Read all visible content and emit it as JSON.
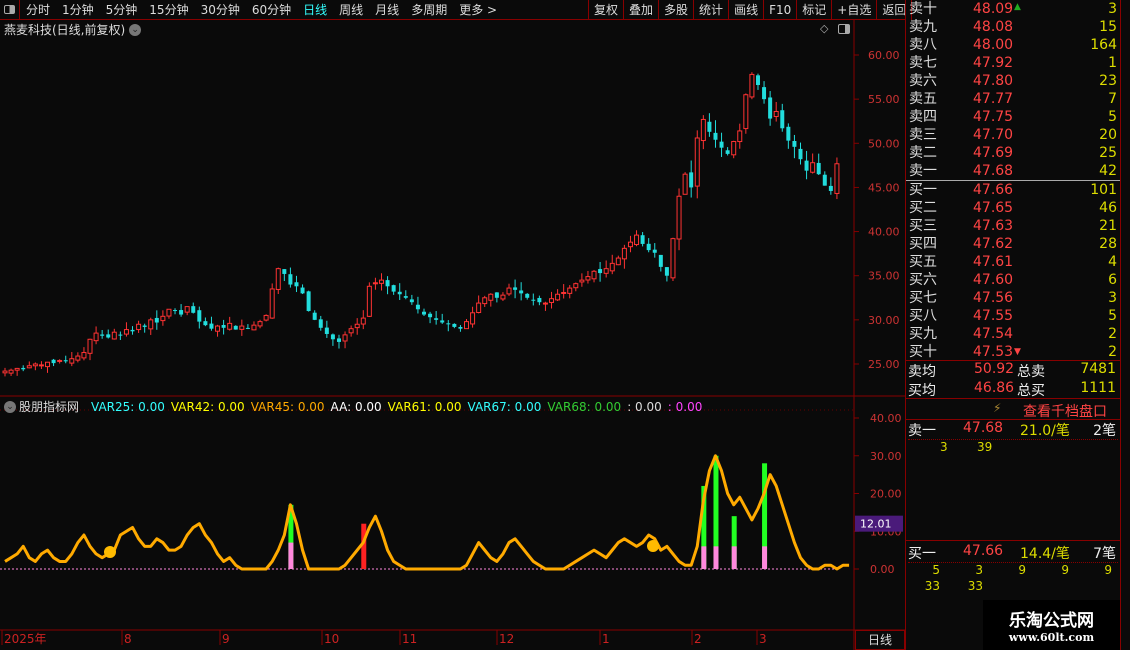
{
  "toolbar": {
    "periods": [
      "分时",
      "1分钟",
      "5分钟",
      "15分钟",
      "30分钟",
      "60分钟",
      "日线",
      "周线",
      "月线",
      "多周期",
      "更多 >"
    ],
    "active": "日线",
    "buttons": [
      "复权",
      "叠加",
      "多股",
      "统计",
      "画线",
      "F10",
      "标记",
      "+自选",
      "返回"
    ]
  },
  "chart": {
    "title": "燕麦科技(日线,前复权)",
    "price_ticks": [
      "60.00",
      "55.00",
      "50.00",
      "45.00",
      "40.00",
      "35.00",
      "30.00",
      "25.00"
    ],
    "closes": [
      24.2,
      24.3,
      24.5,
      24.4,
      24.8,
      25.0,
      24.9,
      25.2,
      25.1,
      25.4,
      25.3,
      25.6,
      25.9,
      26.3,
      27.8,
      28.5,
      28.2,
      28.0,
      28.6,
      28.3,
      28.9,
      28.7,
      29.5,
      29.2,
      30.0,
      29.7,
      30.4,
      31.2,
      31.0,
      30.6,
      31.5,
      30.8,
      29.8,
      29.4,
      29.0,
      29.3,
      29.1,
      29.6,
      28.9,
      29.3,
      29.0,
      29.4,
      29.8,
      30.5,
      33.5,
      35.8,
      35.2,
      34.0,
      33.8,
      33.0,
      31.0,
      30.0,
      29.1,
      28.4,
      27.8,
      27.5,
      28.3,
      29.0,
      29.5,
      30.2,
      33.8,
      34.2,
      34.5,
      33.8,
      33.2,
      32.9,
      32.5,
      32.0,
      31.2,
      30.6,
      30.3,
      30.0,
      29.7,
      29.5,
      29.2,
      29.0,
      29.8,
      30.8,
      31.9,
      32.5,
      32.9,
      32.5,
      32.8,
      33.6,
      33.4,
      33.0,
      32.5,
      32.2,
      32.0,
      31.9,
      32.4,
      32.9,
      33.1,
      33.6,
      34.1,
      34.5,
      34.9,
      35.5,
      35.3,
      35.8,
      36.4,
      37.0,
      38.1,
      38.8,
      39.6,
      38.6,
      37.9,
      37.6,
      36.0,
      35.0,
      39.2,
      44.0,
      46.5,
      45.0,
      50.6,
      52.7,
      51.3,
      50.4,
      49.5,
      48.8,
      50.2,
      51.4,
      55.5,
      57.8,
      56.6,
      55.0,
      52.8,
      53.6,
      51.7,
      50.3,
      49.6,
      48.2,
      46.9,
      47.8,
      46.5,
      45.2,
      44.6,
      47.68
    ]
  },
  "indicator": {
    "name": "股朋指标网",
    "vars": [
      {
        "label": "VAR25: 0.00",
        "color": "#3ff"
      },
      {
        "label": "VAR42: 0.00",
        "color": "#ff0"
      },
      {
        "label": "VAR45: 0.00",
        "color": "#fa0"
      },
      {
        "label": "AA: 0.00",
        "color": "#fff"
      },
      {
        "label": "VAR61: 0.00",
        "color": "#ff0"
      },
      {
        "label": "VAR67: 0.00",
        "color": "#3ff"
      },
      {
        "label": "VAR68: 0.00",
        "color": "#3c3"
      },
      {
        "label": ": 0.00",
        "color": "#ddd"
      },
      {
        "label": ": 0.00",
        "color": "#f4f"
      }
    ],
    "ticks": [
      "40.00",
      "30.00",
      "20.00",
      "10.00",
      "0.00"
    ],
    "current": "12.01",
    "line": [
      2,
      3,
      4,
      6,
      3,
      2,
      4,
      5,
      3,
      2,
      2,
      4,
      7,
      9,
      6,
      4,
      3,
      4,
      5,
      9,
      10,
      11,
      8,
      6,
      6,
      8,
      7,
      5,
      5,
      6,
      9,
      11,
      12,
      9,
      7,
      4,
      2,
      3,
      1,
      0,
      0,
      0,
      0,
      0,
      2,
      5,
      9,
      17,
      12,
      5,
      0,
      0,
      0,
      0,
      0,
      0,
      1,
      3,
      5,
      7,
      11,
      14,
      10,
      5,
      2,
      1,
      0,
      0,
      0,
      0,
      0,
      0,
      0,
      0,
      0,
      0,
      1,
      4,
      7,
      5,
      3,
      2,
      4,
      7,
      8,
      6,
      4,
      2,
      1,
      0,
      0,
      0,
      0,
      1,
      2,
      3,
      4,
      5,
      4,
      3,
      5,
      7,
      8,
      7,
      6,
      7,
      9,
      8,
      5,
      6,
      4,
      2,
      1,
      1,
      6,
      18,
      26,
      30,
      26,
      20,
      17,
      19,
      16,
      13,
      16,
      20,
      25,
      22,
      17,
      12,
      7,
      3,
      1,
      0,
      0,
      1,
      1,
      0,
      1,
      1
    ],
    "bars": [
      {
        "i": 47,
        "v": 17,
        "c": "#2f2"
      },
      {
        "i": 59,
        "v": 12,
        "c": "#f22"
      },
      {
        "i": 115,
        "v": 22,
        "c": "#2f2"
      },
      {
        "i": 117,
        "v": 30,
        "c": "#2f2"
      },
      {
        "i": 120,
        "v": 14,
        "c": "#2f2"
      },
      {
        "i": 125,
        "v": 28,
        "c": "#2f2"
      },
      {
        "i": 47,
        "v": 7,
        "c": "#f8d"
      },
      {
        "i": 115,
        "v": 6,
        "c": "#f8d"
      },
      {
        "i": 117,
        "v": 6,
        "c": "#f8d"
      },
      {
        "i": 120,
        "v": 6,
        "c": "#f8d"
      },
      {
        "i": 125,
        "v": 6,
        "c": "#f8d"
      }
    ]
  },
  "time_axis": {
    "labels": [
      "2025年",
      "8",
      "9",
      "10",
      "11",
      "12",
      "1",
      "2",
      "3"
    ],
    "period": "日线"
  },
  "orderbook": {
    "asks": [
      [
        "卖十",
        "48.09",
        "3"
      ],
      [
        "卖九",
        "48.08",
        "15"
      ],
      [
        "卖八",
        "48.00",
        "164"
      ],
      [
        "卖七",
        "47.92",
        "1"
      ],
      [
        "卖六",
        "47.80",
        "23"
      ],
      [
        "卖五",
        "47.77",
        "7"
      ],
      [
        "卖四",
        "47.75",
        "5"
      ],
      [
        "卖三",
        "47.70",
        "20"
      ],
      [
        "卖二",
        "47.69",
        "25"
      ],
      [
        "卖一",
        "47.68",
        "42"
      ]
    ],
    "bids": [
      [
        "买一",
        "47.66",
        "101"
      ],
      [
        "买二",
        "47.65",
        "46"
      ],
      [
        "买三",
        "47.63",
        "21"
      ],
      [
        "买四",
        "47.62",
        "28"
      ],
      [
        "买五",
        "47.61",
        "4"
      ],
      [
        "买六",
        "47.60",
        "6"
      ],
      [
        "买七",
        "47.56",
        "3"
      ],
      [
        "买八",
        "47.55",
        "5"
      ],
      [
        "买九",
        "47.54",
        "2"
      ],
      [
        "买十",
        "47.53",
        "2"
      ]
    ],
    "avg_sell_label": "卖均",
    "avg_sell": "50.92",
    "total_sell_label": "总卖",
    "total_sell": "7481",
    "avg_buy_label": "买均",
    "avg_buy": "46.86",
    "total_buy_label": "总买",
    "total_buy": "1111",
    "view_more": "查看千档盘口",
    "sell1": {
      "label": "卖一",
      "price": "47.68",
      "avg": "21.0/笔",
      "count": "2笔",
      "queue": [
        "3",
        "39"
      ]
    },
    "buy1": {
      "label": "买一",
      "price": "47.66",
      "avg": "14.4/笔",
      "count": "7笔",
      "queue": [
        "5",
        "3",
        "9",
        "9",
        "9",
        "33",
        "33"
      ]
    }
  },
  "watermark": {
    "name": "乐淘公式网",
    "url": "www.60lt.com"
  }
}
